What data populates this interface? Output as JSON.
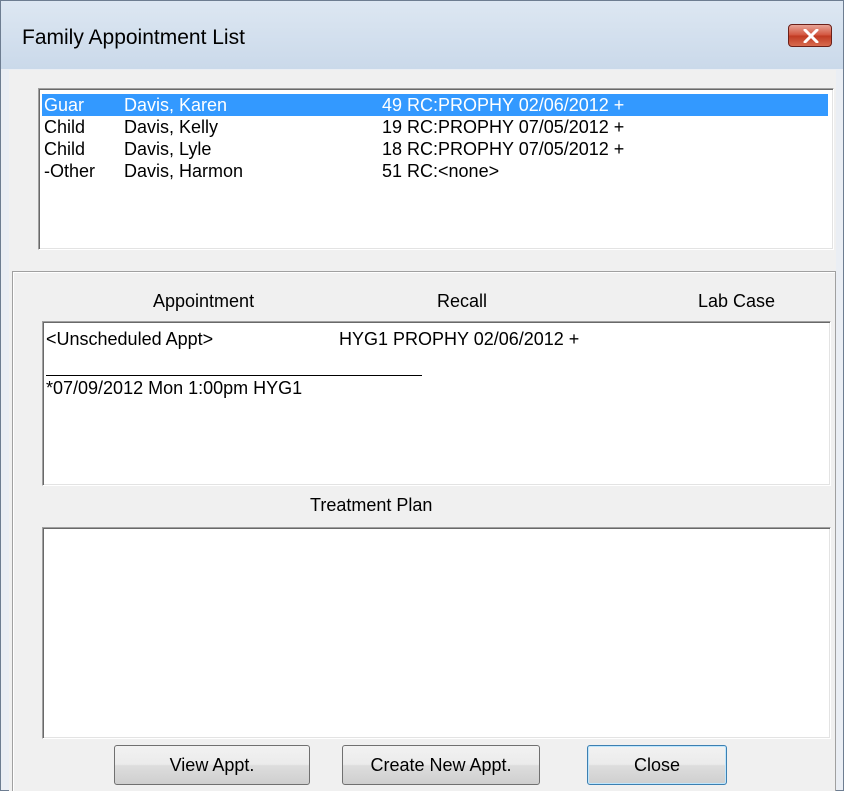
{
  "window": {
    "title": "Family Appointment List"
  },
  "family": {
    "members": [
      {
        "relation": "Guar",
        "name": "Davis, Karen",
        "info": "49  RC:PROPHY 02/06/2012 +",
        "selected": true
      },
      {
        "relation": "Child",
        "name": "Davis, Kelly",
        "info": "19  RC:PROPHY 07/05/2012 +",
        "selected": false
      },
      {
        "relation": "Child",
        "name": "Davis, Lyle",
        "info": "18  RC:PROPHY 07/05/2012 +",
        "selected": false
      },
      {
        "relation": "-Other",
        "name": "Davis, Harmon",
        "info": "51  RC:<none>",
        "selected": false
      }
    ]
  },
  "details": {
    "headers": {
      "appointment": "Appointment",
      "recall": "Recall",
      "lab_case": "Lab Case"
    },
    "appointments": {
      "unscheduled_label": "<Unscheduled Appt>",
      "unscheduled_recall": "HYG1  PROPHY 02/06/2012 +",
      "scheduled": "*07/09/2012  Mon   1:00pm   HYG1"
    },
    "treatment_plan_label": "Treatment Plan"
  },
  "buttons": {
    "view": "View Appt.",
    "create": "Create New Appt.",
    "close": "Close"
  },
  "colors": {
    "selection": "#3399ff",
    "close_button": "#c8442c"
  },
  "icons": {
    "title_close": "close-icon"
  }
}
